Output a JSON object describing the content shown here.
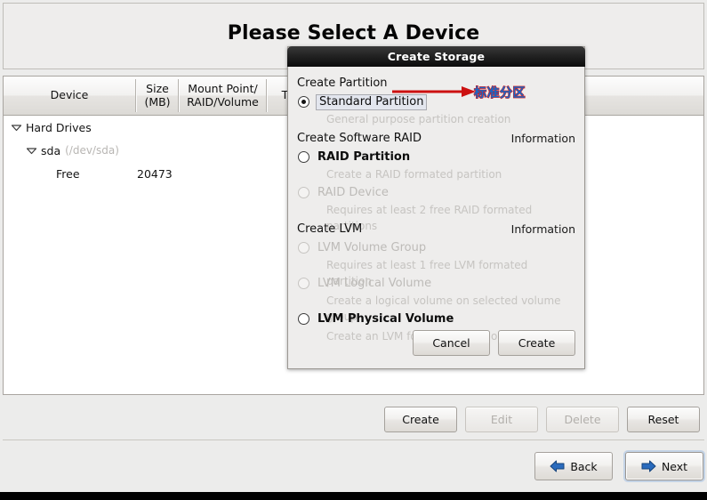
{
  "window": {
    "banner_title": "Please Select A Device"
  },
  "device_table": {
    "columns": [
      {
        "key": "device",
        "label": "Device"
      },
      {
        "key": "size",
        "label": "Size\n(MB)",
        "line1": "Size",
        "line2": "(MB)"
      },
      {
        "key": "mount",
        "label": "Mount Point/\nRAID/Volume",
        "line1": "Mount Point/",
        "line2": "RAID/Volume"
      },
      {
        "key": "type",
        "label": "Type"
      }
    ],
    "rows": [
      {
        "indent": 0,
        "expander": "expanded",
        "name": "Hard Drives",
        "sub": "",
        "size": ""
      },
      {
        "indent": 1,
        "expander": "expanded",
        "name": "sda",
        "sub": "(/dev/sda)",
        "size": ""
      },
      {
        "indent": 2,
        "expander": "none",
        "name": "Free",
        "sub": "",
        "size": "20473"
      }
    ]
  },
  "action_bar": {
    "create_label": "Create",
    "edit_label": "Edit",
    "delete_label": "Delete",
    "reset_label": "Reset"
  },
  "nav_bar": {
    "back_label": "Back",
    "next_label": "Next"
  },
  "dialog": {
    "title": "Create Storage",
    "sections": [
      {
        "heading": "Create Partition",
        "info": "",
        "options": [
          {
            "label": "Standard Partition",
            "description": "General purpose partition creation",
            "state": "checked",
            "selected": true,
            "disabled": false
          }
        ]
      },
      {
        "heading": "Create Software RAID",
        "info": "Information",
        "options": [
          {
            "label": "RAID Partition",
            "description": "Create a RAID formated partition",
            "state": "unchecked",
            "selected": false,
            "disabled": false
          },
          {
            "label": "RAID Device",
            "description": "Requires at least 2 free RAID formated partitions",
            "state": "unchecked",
            "selected": false,
            "disabled": true
          }
        ]
      },
      {
        "heading": "Create LVM",
        "info": "Information",
        "options": [
          {
            "label": "LVM Volume Group",
            "description": "Requires at least 1 free LVM formated partition",
            "state": "unchecked",
            "selected": false,
            "disabled": true
          },
          {
            "label": "LVM Logical Volume",
            "description": "Create a logical volume on selected volume group",
            "state": "unchecked",
            "selected": false,
            "disabled": true
          },
          {
            "label": "LVM Physical Volume",
            "description": "Create an LVM formated partition",
            "state": "unchecked",
            "selected": false,
            "disabled": false
          }
        ]
      }
    ],
    "cancel_label": "Cancel",
    "create_label": "Create"
  },
  "annotation": {
    "text": "标准分区",
    "text_color": "#1668c8",
    "outline_color": "#d81515",
    "arrow_color": "#cc1111"
  }
}
